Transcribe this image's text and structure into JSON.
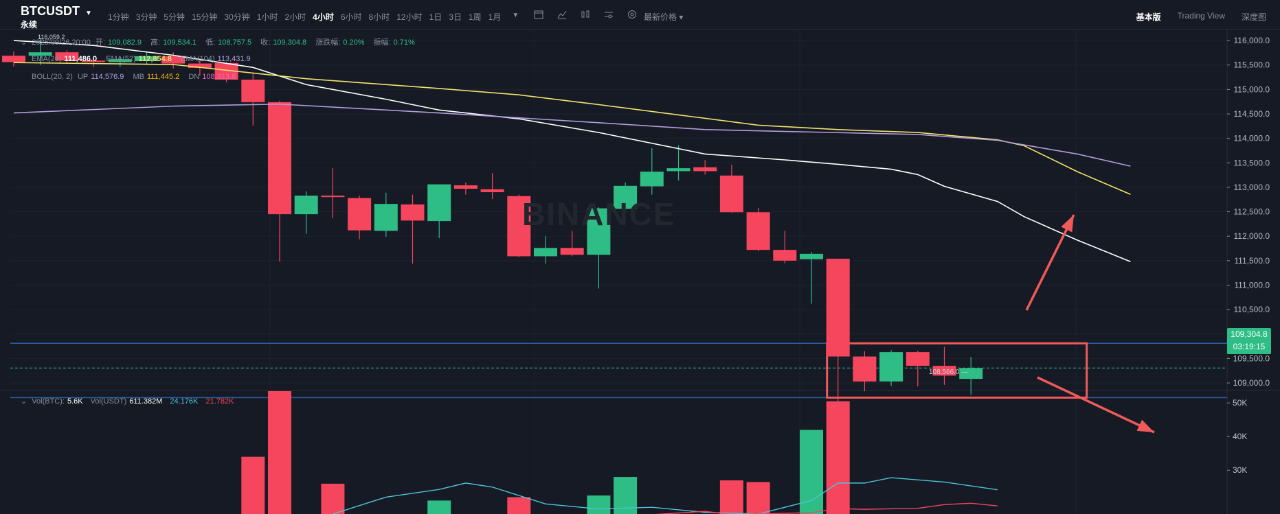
{
  "header": {
    "symbol": "BTCUSDT",
    "contract_type": "永续",
    "intervals": [
      "1分钟",
      "3分钟",
      "5分钟",
      "15分钟",
      "30分钟",
      "1小时",
      "2小时",
      "4小时",
      "6小时",
      "8小时",
      "12小时",
      "1日",
      "3日",
      "1周",
      "1月"
    ],
    "active_interval": "4小时",
    "price_type": "最新价格 ▾",
    "tabs": [
      "基本版",
      "Trading View",
      "深度图"
    ],
    "active_tab": "基本版",
    "tool_icons": [
      "calendar-icon",
      "indicator-icon",
      "compare-icon",
      "settings-icon",
      "gear-circle-icon"
    ]
  },
  "info": {
    "datetime": "2025/09/26 20:00",
    "open_label": "开:",
    "open": "109,082.9",
    "high_label": "高:",
    "high": "109,534.1",
    "low_label": "低:",
    "low": "108,757.5",
    "close_label": "收:",
    "close": "109,304.8",
    "change_label": "涨跌幅:",
    "change": "0.20%",
    "amp_label": "振幅:",
    "amp": "0.71%"
  },
  "ema": {
    "ema1_label": "EMA(26)",
    "ema1": "111,486.0",
    "ema2_label": "EMA(52)",
    "ema2": "112,854.8",
    "ema3_label": "EMA(104)",
    "ema3": "113,431.9"
  },
  "boll": {
    "label": "BOLL(20, 2)",
    "up_label": "UP",
    "up": "114,576.9",
    "mb_label": "MB",
    "mb": "111,445.2",
    "dn_label": "DN",
    "dn": "108,313.8"
  },
  "vol": {
    "btc_label": "Vol(BTC):",
    "btc": "5.6K",
    "usdt_label": "Vol(USDT)",
    "usdt": "611.382M",
    "ma1": "24.176K",
    "ma2": "21.782K"
  },
  "price_tag": {
    "price": "109,304.8",
    "countdown": "03:19:15"
  },
  "low_marker": "108,566.0 —",
  "high_marker": "116,059.2",
  "watermark": "BINANCE",
  "colors": {
    "up": "#2ebd85",
    "down": "#f6465d",
    "ema1": "#ffffff",
    "ema2": "#f0e36b",
    "ema3": "#b39ddb",
    "box": "#f05a5a",
    "hline": "#2b5fa8",
    "ma_vol1": "#4fc3d7",
    "ma_vol2": "#f6465d"
  },
  "chart_data": {
    "type": "candlestick",
    "price_axis_ticks": [
      116000,
      115500,
      115000,
      114500,
      114000,
      113500,
      113000,
      112500,
      112000,
      111500,
      111000,
      110500,
      110000,
      109500,
      109000
    ],
    "price_axis_labels": [
      "116,000.0",
      "115,500.0",
      "115,000.0",
      "114,500.0",
      "114,000.0",
      "113,500.0",
      "113,000.0",
      "112,500.0",
      "112,000.0",
      "111,500.0",
      "111,000.0",
      "110,500.0",
      "110,000.0",
      "109,500.0",
      "109,000.0"
    ],
    "ylim": [
      108860,
      116240
    ],
    "volume_axis_ticks": [
      50000,
      40000,
      30000
    ],
    "volume_axis_labels": [
      "50K",
      "40K",
      "30K"
    ],
    "volume_ylim": [
      17000,
      53500
    ],
    "candles": [
      {
        "o": 115690,
        "h": 115780,
        "l": 115470,
        "c": 115560
      },
      {
        "o": 115690,
        "h": 116059,
        "l": 115500,
        "c": 115760
      },
      {
        "o": 115760,
        "h": 115800,
        "l": 115550,
        "c": 115590
      },
      {
        "o": 115590,
        "h": 115680,
        "l": 115460,
        "c": 115560
      },
      {
        "o": 115560,
        "h": 115660,
        "l": 115460,
        "c": 115620
      },
      {
        "o": 115580,
        "h": 115760,
        "l": 115500,
        "c": 115680
      },
      {
        "o": 115680,
        "h": 115760,
        "l": 115430,
        "c": 115530
      },
      {
        "o": 115530,
        "h": 115610,
        "l": 115280,
        "c": 115440
      },
      {
        "o": 115540,
        "h": 115560,
        "l": 115150,
        "c": 115200
      },
      {
        "o": 115200,
        "h": 115340,
        "l": 114260,
        "c": 114740
      },
      {
        "o": 114740,
        "h": 114770,
        "l": 111480,
        "c": 112450
      },
      {
        "o": 112450,
        "h": 112920,
        "l": 112050,
        "c": 112830
      },
      {
        "o": 112830,
        "h": 113390,
        "l": 112370,
        "c": 112800
      },
      {
        "o": 112780,
        "h": 112830,
        "l": 111940,
        "c": 112120
      },
      {
        "o": 112110,
        "h": 112890,
        "l": 111990,
        "c": 112660
      },
      {
        "o": 112650,
        "h": 112850,
        "l": 111440,
        "c": 112320
      },
      {
        "o": 112310,
        "h": 113060,
        "l": 111960,
        "c": 113060
      },
      {
        "o": 113040,
        "h": 113100,
        "l": 112850,
        "c": 112970
      },
      {
        "o": 112960,
        "h": 113290,
        "l": 112760,
        "c": 112900
      },
      {
        "o": 112820,
        "h": 112850,
        "l": 111570,
        "c": 111590
      },
      {
        "o": 111590,
        "h": 112000,
        "l": 111440,
        "c": 111760
      },
      {
        "o": 111760,
        "h": 112110,
        "l": 111590,
        "c": 111620
      },
      {
        "o": 111620,
        "h": 112590,
        "l": 110930,
        "c": 112570
      },
      {
        "o": 112560,
        "h": 113100,
        "l": 112530,
        "c": 113030
      },
      {
        "o": 113020,
        "h": 113800,
        "l": 112850,
        "c": 113320
      },
      {
        "o": 113330,
        "h": 113860,
        "l": 113140,
        "c": 113390
      },
      {
        "o": 113410,
        "h": 113560,
        "l": 113260,
        "c": 113330
      },
      {
        "o": 113240,
        "h": 113460,
        "l": 112480,
        "c": 112490
      },
      {
        "o": 112490,
        "h": 112580,
        "l": 111690,
        "c": 111720
      },
      {
        "o": 111720,
        "h": 112110,
        "l": 111450,
        "c": 111500
      },
      {
        "o": 111530,
        "h": 111680,
        "l": 110620,
        "c": 111640
      },
      {
        "o": 111540,
        "h": 111540,
        "l": 108566,
        "c": 109540
      },
      {
        "o": 109540,
        "h": 109650,
        "l": 108830,
        "c": 109030
      },
      {
        "o": 109030,
        "h": 109670,
        "l": 108940,
        "c": 109630
      },
      {
        "o": 109630,
        "h": 109660,
        "l": 108930,
        "c": 109350
      },
      {
        "o": 109350,
        "h": 109740,
        "l": 108960,
        "c": 109150
      },
      {
        "o": 109083,
        "h": 109534,
        "l": 108758,
        "c": 109305
      }
    ],
    "volumes": [
      null,
      null,
      null,
      null,
      null,
      null,
      null,
      null,
      null,
      34000,
      53500,
      null,
      26000,
      null,
      null,
      null,
      21000,
      null,
      null,
      22000,
      null,
      null,
      22500,
      28000,
      null,
      null,
      null,
      27000,
      26500,
      null,
      42000,
      50500,
      null,
      null,
      null,
      null,
      null
    ],
    "ema1": [
      [
        0,
        116000
      ],
      [
        3,
        115900
      ],
      [
        6,
        115700
      ],
      [
        9,
        115450
      ],
      [
        11,
        115100
      ],
      [
        14,
        114800
      ],
      [
        16,
        114580
      ],
      [
        19,
        114400
      ],
      [
        22,
        114120
      ],
      [
        26,
        113680
      ],
      [
        29,
        113560
      ],
      [
        31,
        113470
      ],
      [
        33,
        113370
      ],
      [
        34,
        113260
      ],
      [
        35,
        113020
      ],
      [
        37,
        112710
      ],
      [
        38,
        112400
      ],
      [
        40,
        111920
      ],
      [
        42,
        111480
      ]
    ],
    "ema2": [
      [
        0,
        115550
      ],
      [
        6,
        115510
      ],
      [
        11,
        115220
      ],
      [
        16,
        115020
      ],
      [
        19,
        114890
      ],
      [
        22,
        114690
      ],
      [
        25,
        114480
      ],
      [
        28,
        114270
      ],
      [
        31,
        114180
      ],
      [
        34,
        114120
      ],
      [
        37,
        113970
      ],
      [
        38,
        113850
      ],
      [
        40,
        113320
      ],
      [
        42,
        112855
      ]
    ],
    "ema3": [
      [
        0,
        114520
      ],
      [
        6,
        114660
      ],
      [
        10,
        114700
      ],
      [
        16,
        114520
      ],
      [
        22,
        114320
      ],
      [
        26,
        114180
      ],
      [
        30,
        114130
      ],
      [
        34,
        114080
      ],
      [
        37,
        113960
      ],
      [
        40,
        113680
      ],
      [
        42,
        113432
      ]
    ],
    "vol_ma1": [
      [
        12,
        17000
      ],
      [
        14,
        22000
      ],
      [
        16,
        24300
      ],
      [
        17,
        26200
      ],
      [
        18,
        25000
      ],
      [
        20,
        20000
      ],
      [
        22,
        18500
      ],
      [
        24,
        19000
      ],
      [
        26,
        17500
      ],
      [
        28,
        17000
      ],
      [
        30,
        21000
      ],
      [
        31,
        26200
      ],
      [
        32,
        26200
      ],
      [
        33,
        27800
      ],
      [
        35,
        26500
      ],
      [
        37,
        24200
      ]
    ],
    "vol_ma2": [
      [
        24,
        16800
      ],
      [
        26,
        17800
      ],
      [
        27,
        16800
      ],
      [
        30,
        17400
      ],
      [
        31,
        18600
      ],
      [
        32,
        18400
      ],
      [
        34,
        18700
      ],
      [
        35,
        19800
      ],
      [
        36,
        20200
      ],
      [
        37,
        19400
      ]
    ]
  }
}
